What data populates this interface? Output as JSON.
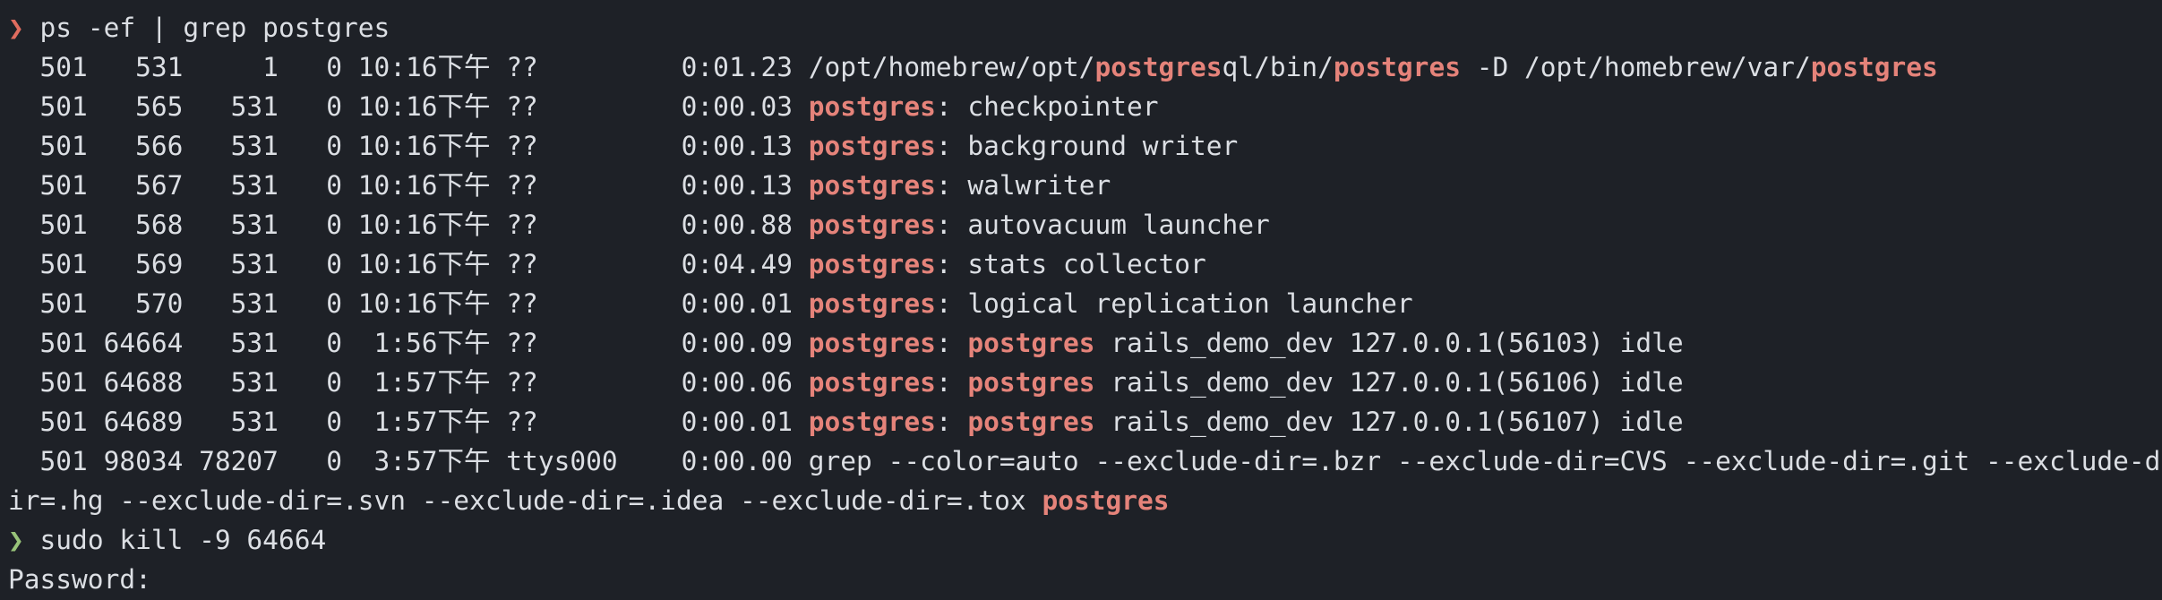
{
  "terminal": {
    "clipped_line": "  ────  ─  ─    ─  ──  ───  ─ ─  ─   ─  ─",
    "prompt1": {
      "symbol": "❯",
      "command": "ps -ef | grep postgres"
    },
    "processes": [
      {
        "cols": "  501   531     1   0 10:16下午 ??         0:01.23 ",
        "parts": [
          {
            "t": "/opt/homebrew/opt/",
            "h": false
          },
          {
            "t": "postgres",
            "h": true
          },
          {
            "t": "ql/bin/",
            "h": false
          },
          {
            "t": "postgres",
            "h": true
          },
          {
            "t": " -D /opt/homebrew/var/",
            "h": false
          },
          {
            "t": "postgres",
            "h": true
          }
        ]
      },
      {
        "cols": "  501   565   531   0 10:16下午 ??         0:00.03 ",
        "parts": [
          {
            "t": "postgres",
            "h": true
          },
          {
            "t": ": checkpointer",
            "h": false
          }
        ]
      },
      {
        "cols": "  501   566   531   0 10:16下午 ??         0:00.13 ",
        "parts": [
          {
            "t": "postgres",
            "h": true
          },
          {
            "t": ": background writer",
            "h": false
          }
        ]
      },
      {
        "cols": "  501   567   531   0 10:16下午 ??         0:00.13 ",
        "parts": [
          {
            "t": "postgres",
            "h": true
          },
          {
            "t": ": walwriter",
            "h": false
          }
        ]
      },
      {
        "cols": "  501   568   531   0 10:16下午 ??         0:00.88 ",
        "parts": [
          {
            "t": "postgres",
            "h": true
          },
          {
            "t": ": autovacuum launcher",
            "h": false
          }
        ]
      },
      {
        "cols": "  501   569   531   0 10:16下午 ??         0:04.49 ",
        "parts": [
          {
            "t": "postgres",
            "h": true
          },
          {
            "t": ": stats collector",
            "h": false
          }
        ]
      },
      {
        "cols": "  501   570   531   0 10:16下午 ??         0:00.01 ",
        "parts": [
          {
            "t": "postgres",
            "h": true
          },
          {
            "t": ": logical replication launcher",
            "h": false
          }
        ]
      },
      {
        "cols": "  501 64664   531   0  1:56下午 ??         0:00.09 ",
        "parts": [
          {
            "t": "postgres",
            "h": true
          },
          {
            "t": ": ",
            "h": false
          },
          {
            "t": "postgres",
            "h": true
          },
          {
            "t": " rails_demo_dev 127.0.0.1(56103) idle",
            "h": false
          }
        ]
      },
      {
        "cols": "  501 64688   531   0  1:57下午 ??         0:00.06 ",
        "parts": [
          {
            "t": "postgres",
            "h": true
          },
          {
            "t": ": ",
            "h": false
          },
          {
            "t": "postgres",
            "h": true
          },
          {
            "t": " rails_demo_dev 127.0.0.1(56106) idle",
            "h": false
          }
        ]
      },
      {
        "cols": "  501 64689   531   0  1:57下午 ??         0:00.01 ",
        "parts": [
          {
            "t": "postgres",
            "h": true
          },
          {
            "t": ": ",
            "h": false
          },
          {
            "t": "postgres",
            "h": true
          },
          {
            "t": " rails_demo_dev 127.0.0.1(56107) idle",
            "h": false
          }
        ]
      },
      {
        "cols": "  501 98034 78207   0  3:57下午 ttys000    0:00.00 ",
        "parts": [
          {
            "t": "grep --color=auto --exclude-dir=.bzr --exclude-dir=CVS --exclude-dir=.git --exclude-d",
            "h": false
          }
        ]
      }
    ],
    "wrap_line": [
      {
        "t": "ir=.hg --exclude-dir=.svn --exclude-dir=.idea --exclude-dir=.tox ",
        "h": false
      },
      {
        "t": "postgres",
        "h": true
      }
    ],
    "prompt2": {
      "symbol": "❯",
      "command": "sudo kill -9 64664"
    },
    "password_prompt": "Password:"
  },
  "colors": {
    "background": "#1e2127",
    "text": "#dcdfe4",
    "highlight": "#e5837a",
    "prompt_error": "#e06c5f",
    "prompt_ok": "#98c379"
  }
}
